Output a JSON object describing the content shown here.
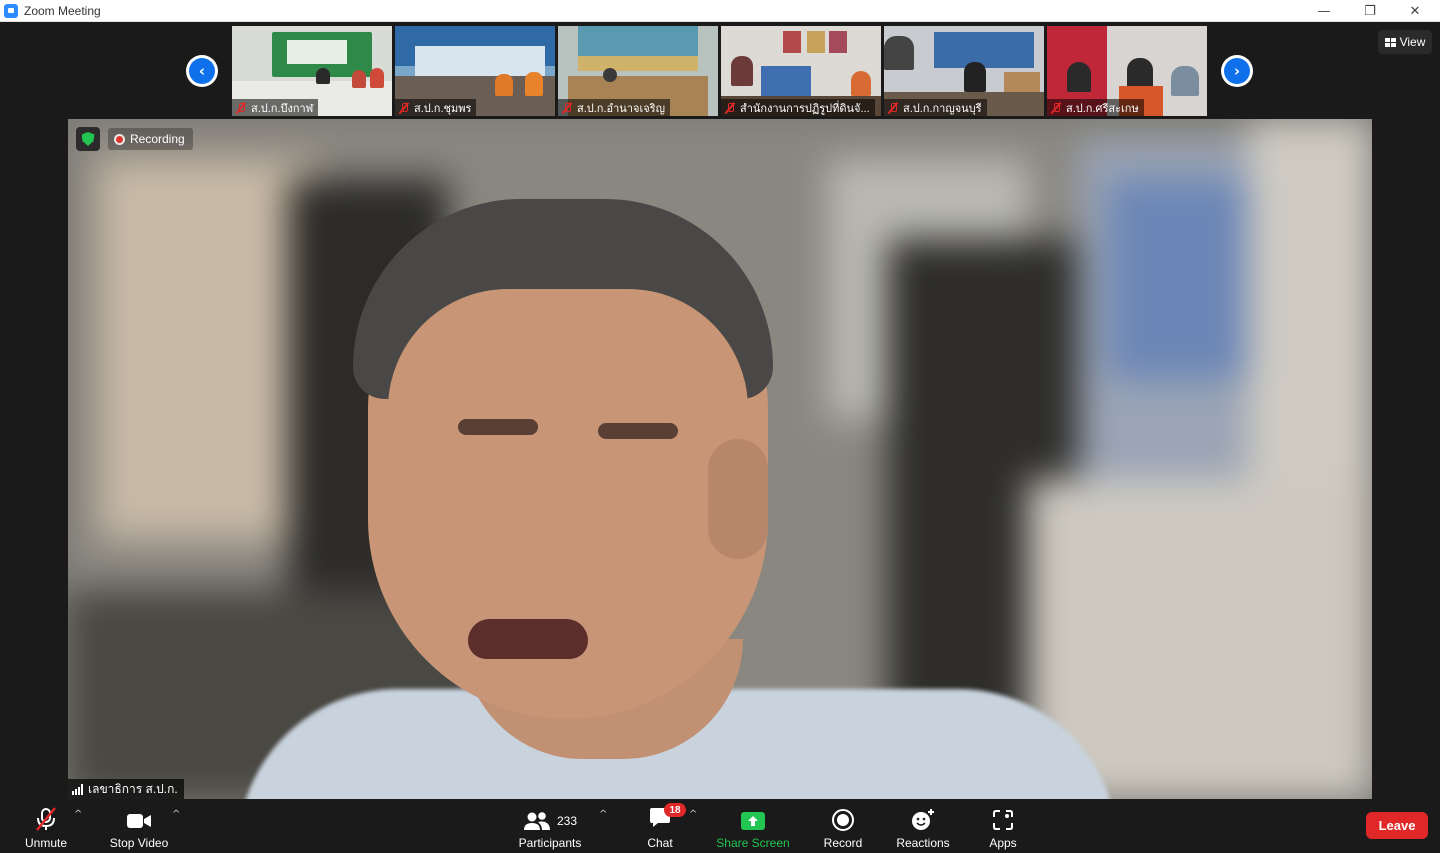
{
  "window": {
    "title": "Zoom Meeting",
    "minimize": "—",
    "restore": "❐",
    "close": "✕"
  },
  "gallery": {
    "prev_arrow": "‹",
    "next_arrow": "›",
    "view_label": "View",
    "participants": [
      {
        "name": "ส.ป.ก.บึงกาฬ"
      },
      {
        "name": "ส.ป.ก.ชุมพร"
      },
      {
        "name": "ส.ป.ก.อำนาจเจริญ"
      },
      {
        "name": "สำนักงานการปฏิรูปที่ดินจั..."
      },
      {
        "name": "ส.ป.ก.กาญจนบุรี"
      },
      {
        "name": "ส.ป.ก.ศรีสะเกษ"
      }
    ]
  },
  "main": {
    "recording_label": "Recording",
    "speaker_name": "เลขาธิการ ส.ป.ก."
  },
  "toolbar": {
    "unmute": "Unmute",
    "stop_video": "Stop Video",
    "participants": "Participants",
    "participants_count": "233",
    "chat": "Chat",
    "chat_badge": "18",
    "share_screen": "Share Screen",
    "record": "Record",
    "reactions": "Reactions",
    "apps": "Apps",
    "leave": "Leave",
    "caret": "^"
  },
  "colors": {
    "accent": "#0e71eb",
    "share_green": "#23c552",
    "leave_red": "#e02828"
  }
}
